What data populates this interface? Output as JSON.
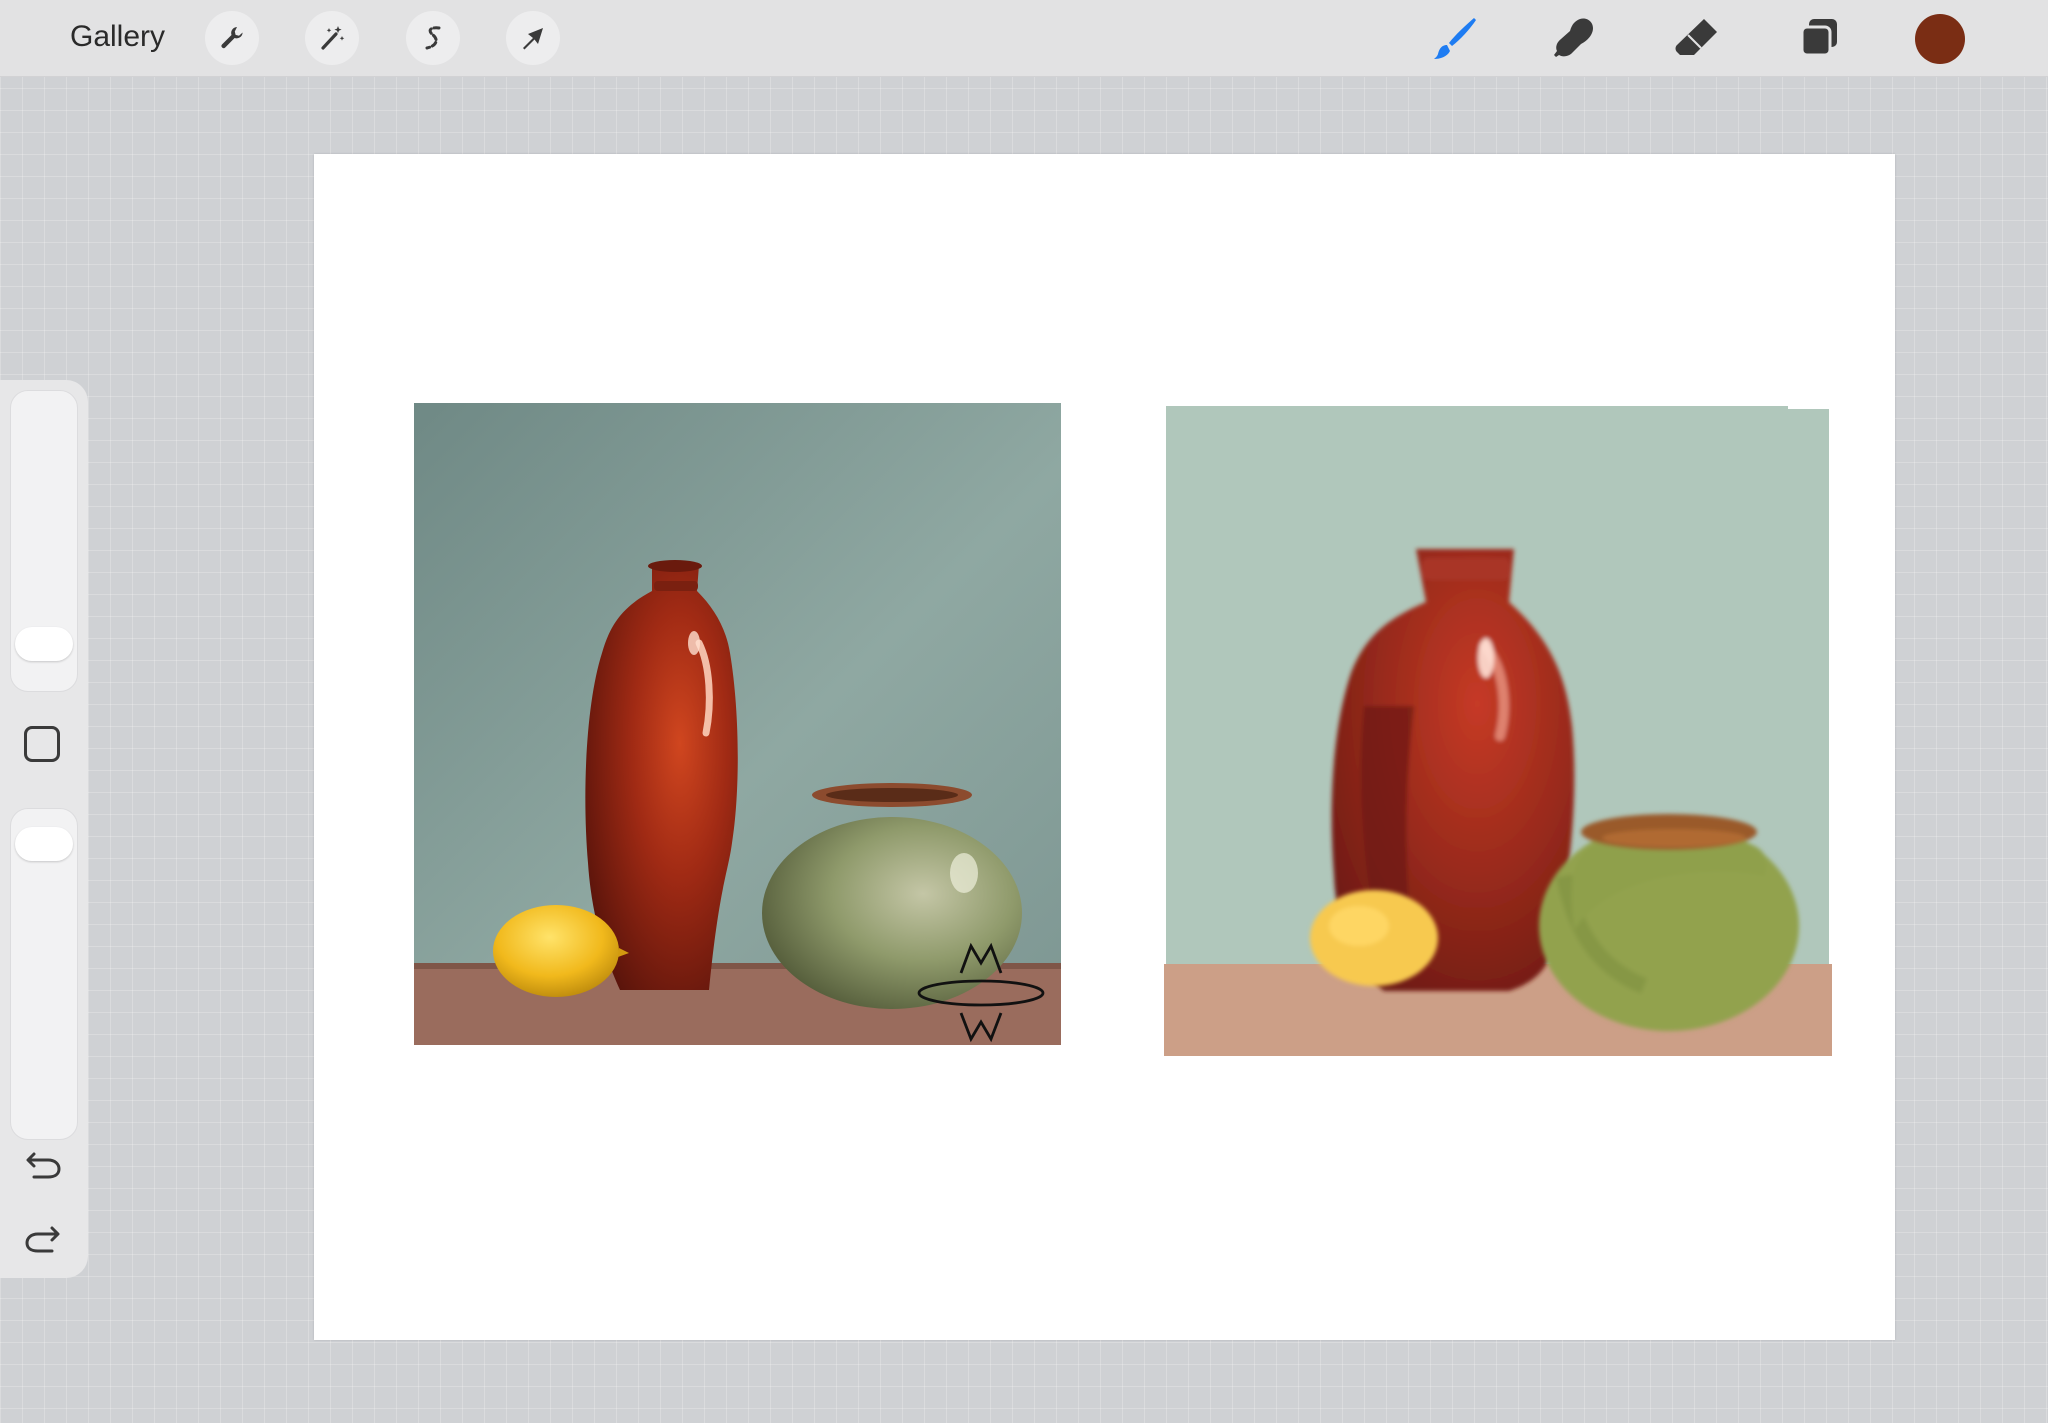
{
  "toolbar": {
    "gallery_label": "Gallery",
    "left_tools": [
      {
        "name": "actions",
        "icon": "wrench-icon"
      },
      {
        "name": "adjustments",
        "icon": "magic-wand-icon"
      },
      {
        "name": "selection",
        "icon": "selection-s-icon"
      },
      {
        "name": "transform",
        "icon": "arrow-cursor-icon"
      }
    ],
    "right_tools": [
      {
        "name": "brush",
        "icon": "brush-icon",
        "active": true
      },
      {
        "name": "smudge",
        "icon": "smudge-finger-icon"
      },
      {
        "name": "eraser",
        "icon": "eraser-icon"
      },
      {
        "name": "layers",
        "icon": "layers-icon"
      }
    ],
    "current_color": "#7a2d14",
    "active_color": "#1e7cf2"
  },
  "sidebar": {
    "brush_size_level": 0.1,
    "opacity_level": 0.95,
    "modify_icon": "square-icon",
    "undo_icon": "undo-icon",
    "redo_icon": "redo-icon"
  },
  "canvas": {
    "reference_signature": "MW",
    "colors": {
      "background_teal": "#b0c7bb",
      "table_tan": "#cc9f87",
      "vase_red": "#9b2b1c",
      "pot_green": "#92a24e",
      "pot_rim": "#9a5a2a",
      "lemon_yellow": "#f7c94f"
    }
  }
}
